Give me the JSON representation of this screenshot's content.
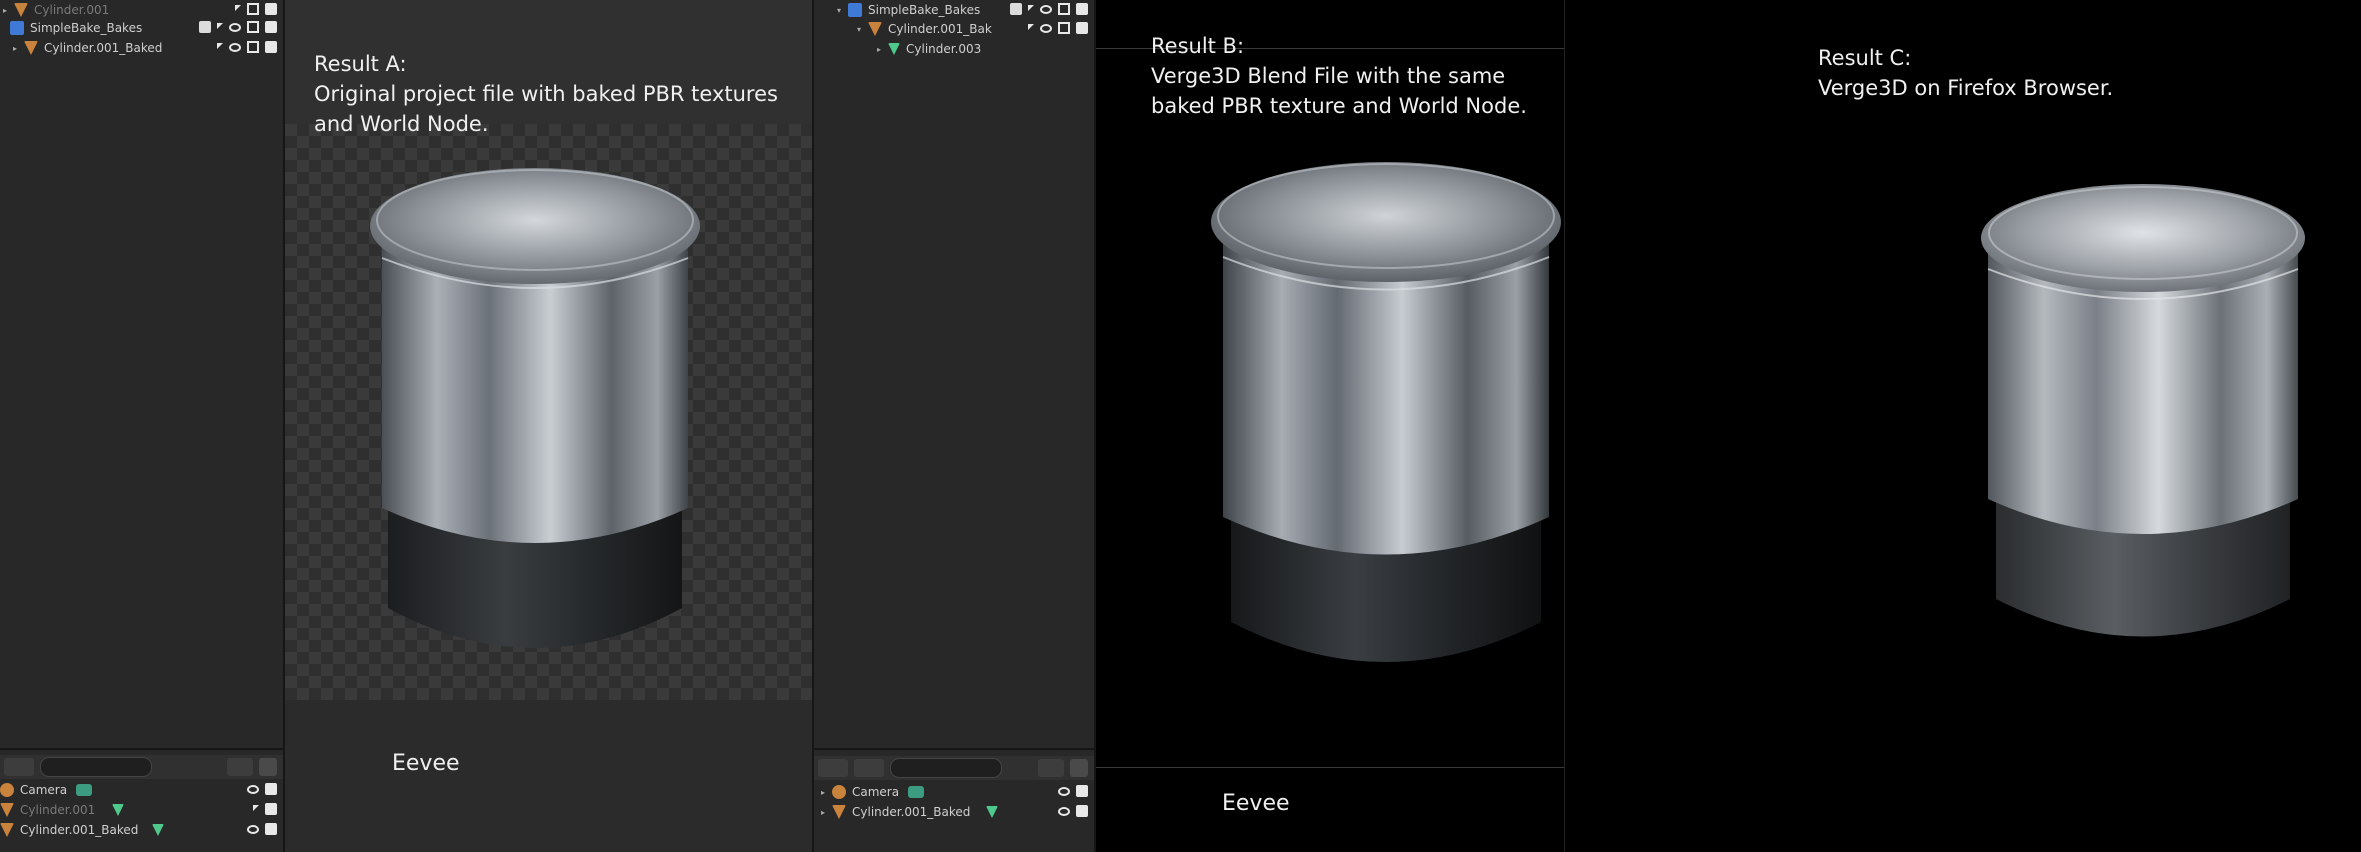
{
  "left_outliner": {
    "top_rows": [
      {
        "label": "Cylinder.001",
        "dim": true
      },
      {
        "label": "SimpleBake_Bakes",
        "dim": false
      },
      {
        "label": "Cylinder.001_Baked",
        "dim": false
      }
    ],
    "bottom_rows": [
      {
        "label": "Camera",
        "dim": false
      },
      {
        "label": "Cylinder.001",
        "dim": true
      },
      {
        "label": "Cylinder.001_Baked",
        "dim": false
      }
    ]
  },
  "result_a": {
    "caption": [
      "Result A:",
      "Original project file with baked PBR textures",
      "and World Node."
    ],
    "engine": "Eevee"
  },
  "mid_outliner": {
    "top_rows": [
      {
        "label": "SimpleBake_Bakes"
      },
      {
        "label": "Cylinder.001_Bak"
      },
      {
        "label": "Cylinder.003"
      }
    ],
    "bottom_rows": [
      {
        "label": "Camera"
      },
      {
        "label": "Cylinder.001_Baked"
      }
    ]
  },
  "result_b": {
    "caption": [
      "Result B:",
      "Verge3D Blend File with the same",
      "baked PBR texture and World Node."
    ],
    "engine": "Eevee"
  },
  "result_c": {
    "caption": [
      "Result C:",
      "Verge3D on Firefox Browser."
    ]
  }
}
